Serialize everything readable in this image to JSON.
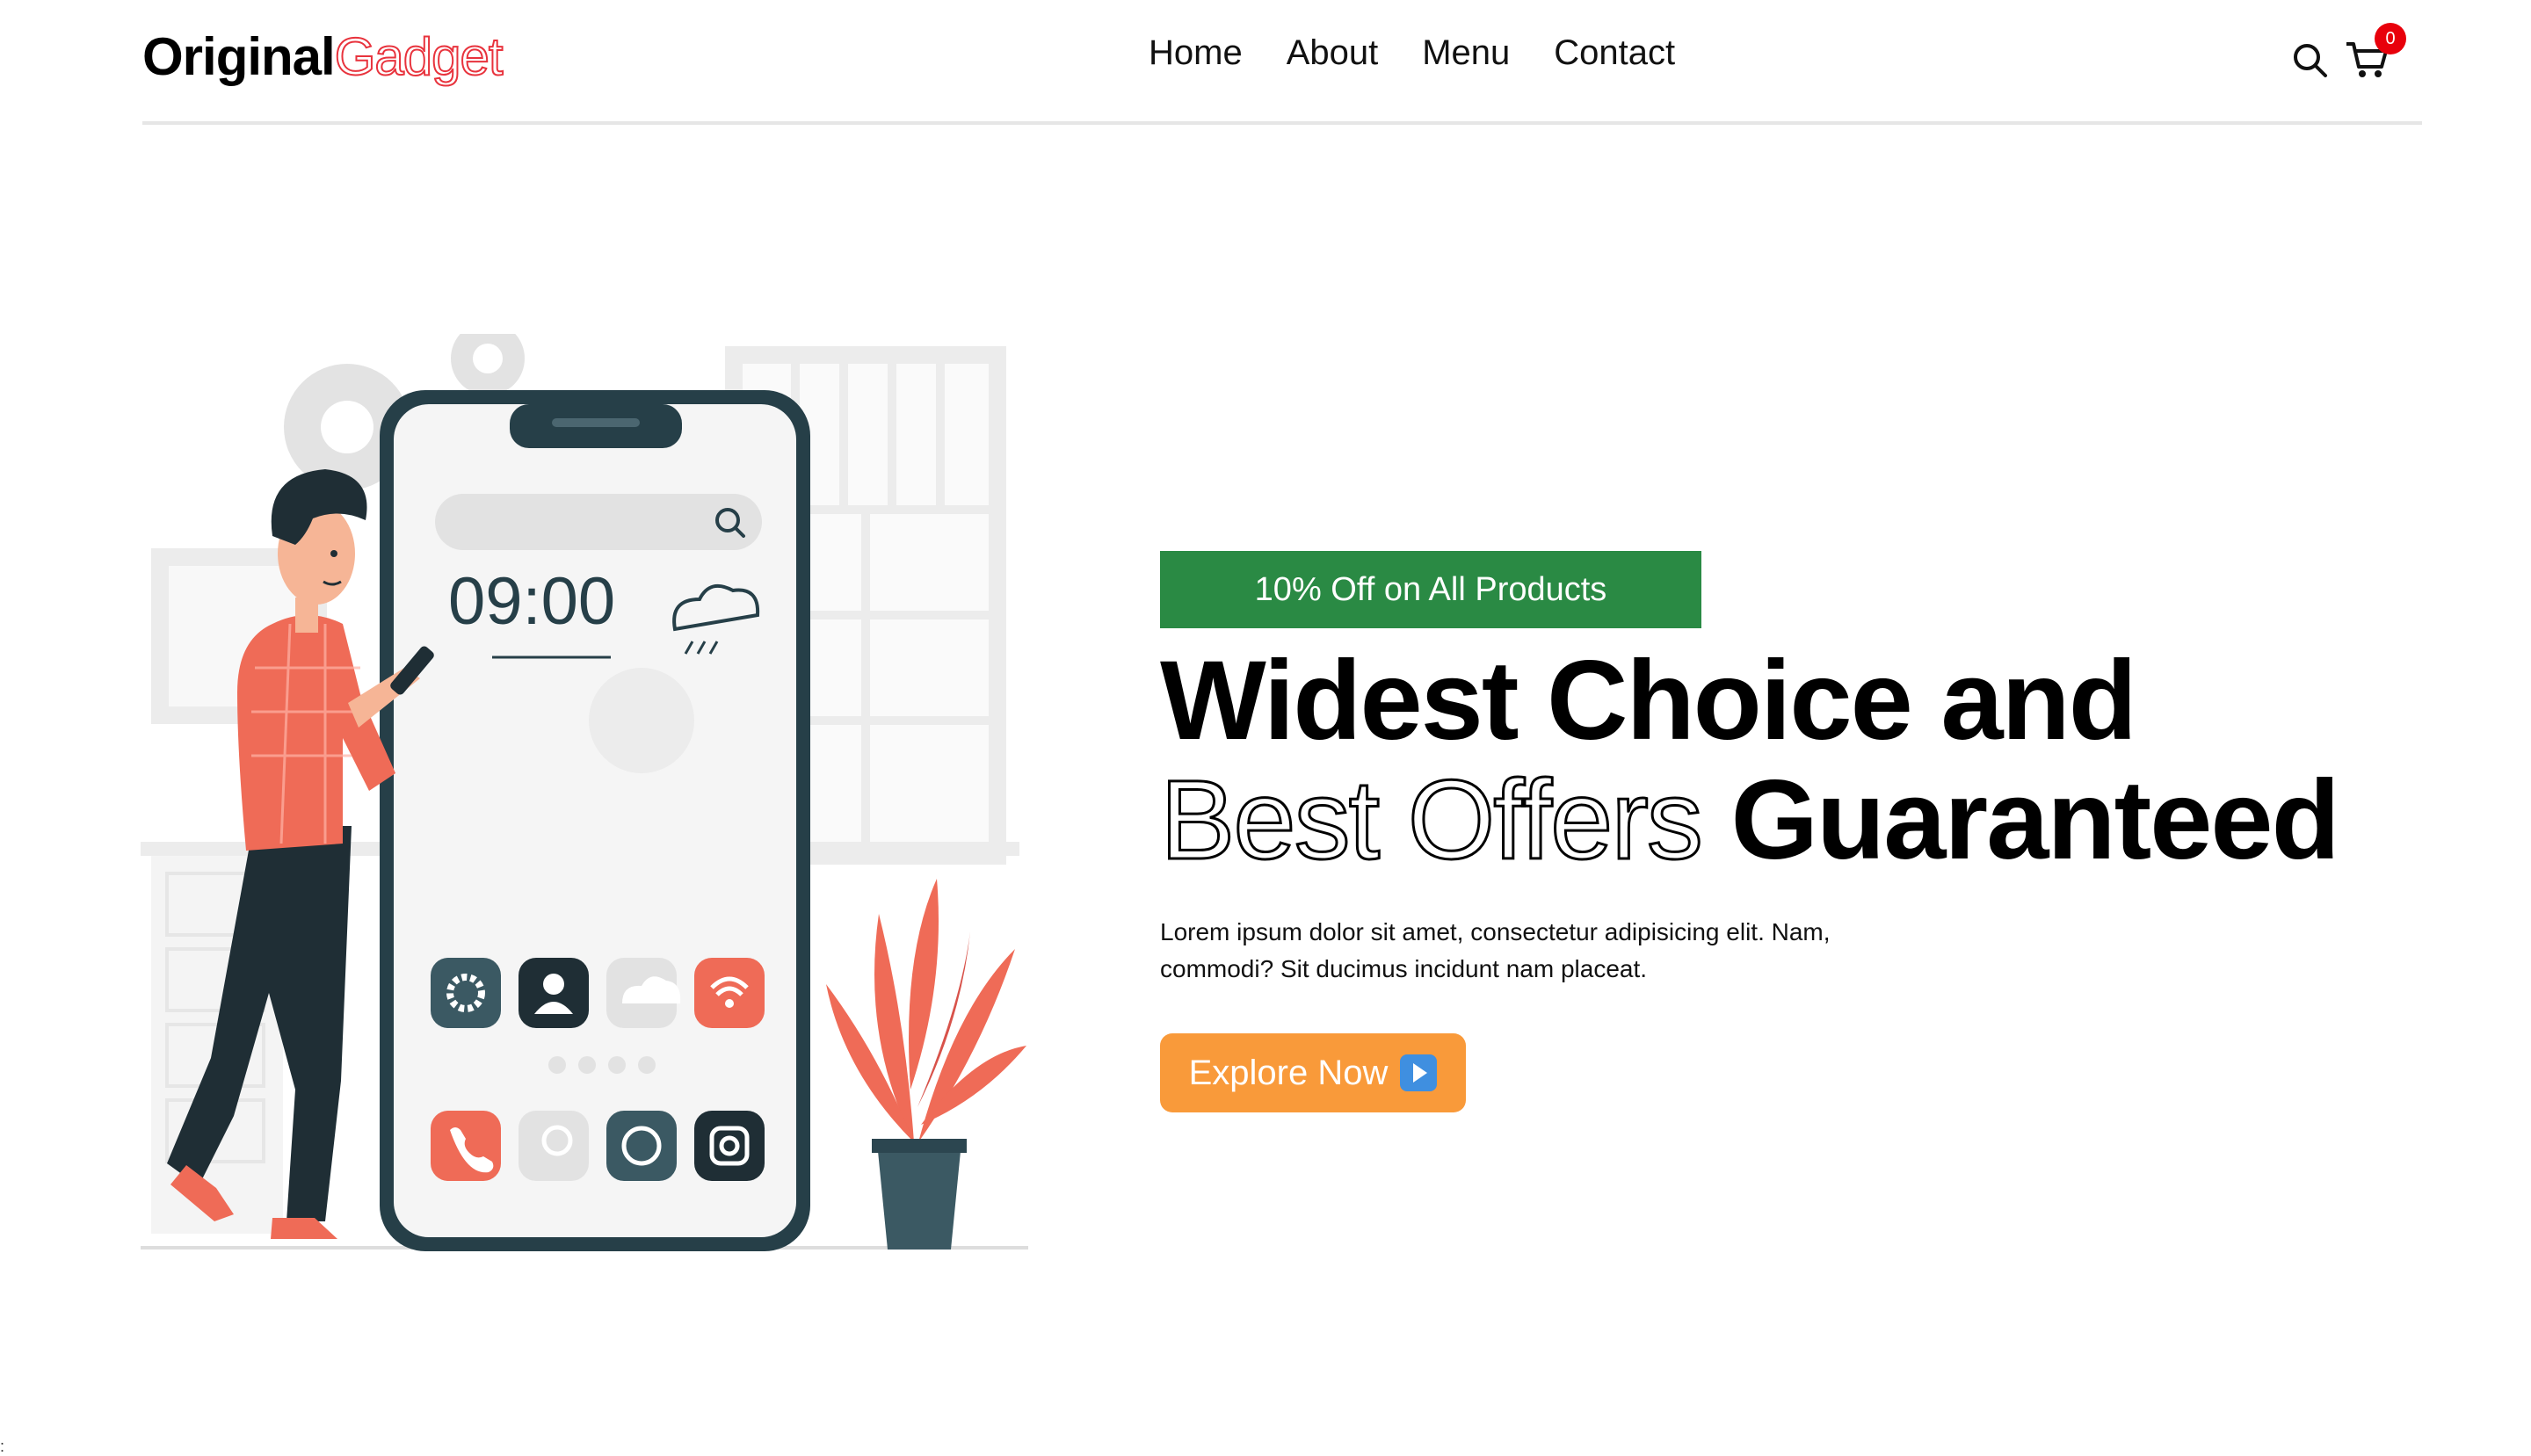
{
  "brand": {
    "name_part1": "Original",
    "name_part2": "Gadget",
    "accent_color": "#e8333d"
  },
  "nav": {
    "links": [
      {
        "label": "Home"
      },
      {
        "label": "About"
      },
      {
        "label": "Menu"
      },
      {
        "label": "Contact"
      }
    ]
  },
  "icons": {
    "search": "search-icon",
    "cart": "cart-icon"
  },
  "cart": {
    "count": "0",
    "badge_color": "#e8000b"
  },
  "hero": {
    "offer_badge": "10% Off on All Products",
    "offer_badge_color": "#2a8a44",
    "title_line1": "Widest Choice and",
    "title_outline": "Best Offers",
    "title_bold": "Guaranteed",
    "description": "Lorem ipsum dolor sit amet, consectetur adipisicing elit. Nam, commodi? Sit ducimus incidunt nam placeat.",
    "cta_label": "Explore Now",
    "cta_color": "#f99a3a"
  },
  "illustration": {
    "phone_time": "09:00"
  },
  "stray_char": ":"
}
